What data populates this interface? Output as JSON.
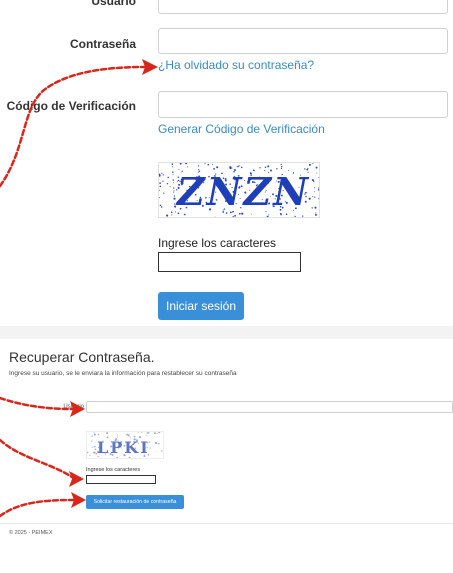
{
  "login": {
    "user_label": "Usuario",
    "password_label": "Contraseña",
    "forgot_link": "¿Ha olvidado su contraseña?",
    "verification_label": "Código de Verificación",
    "generate_link": "Generar Código de Verificación",
    "captcha_text": "ZNZN",
    "captcha_prompt": "Ingrese los caracteres",
    "captcha_value": "",
    "login_button": "Iniciar sesión"
  },
  "recover": {
    "title": "Recuperar Contraseña.",
    "instructions": "Ingrese su usuario, se le enviara la información para restablecer su contraseña",
    "user_label": "Usuario",
    "captcha_text": "LPKI",
    "captcha_prompt": "Ingrese los caracteres",
    "captcha_value": "",
    "submit_button": "Solicitar restauración de contraseña",
    "footer": "© 2025 - PEIMEX"
  },
  "colors": {
    "annotation_arrow": "#d9261c",
    "link": "#3a8bc4",
    "button": "#3a8fd9",
    "captcha_ink": "#1f3fb8"
  }
}
